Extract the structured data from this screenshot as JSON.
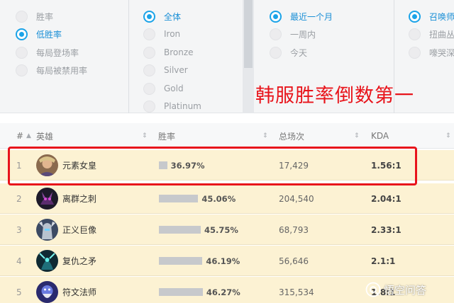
{
  "filters": {
    "stat_type": {
      "options": [
        {
          "label": "胜率",
          "selected": false
        },
        {
          "label": "低胜率",
          "selected": true
        },
        {
          "label": "每局登场率",
          "selected": false
        },
        {
          "label": "每局被禁用率",
          "selected": false
        }
      ]
    },
    "tier": {
      "options": [
        {
          "label": "全体",
          "selected": true
        },
        {
          "label": "Iron",
          "selected": false
        },
        {
          "label": "Bronze",
          "selected": false
        },
        {
          "label": "Silver",
          "selected": false
        },
        {
          "label": "Gold",
          "selected": false
        },
        {
          "label": "Platinum",
          "selected": false
        }
      ]
    },
    "period": {
      "options": [
        {
          "label": "最近一个月",
          "selected": true
        },
        {
          "label": "一周内",
          "selected": false
        },
        {
          "label": "今天",
          "selected": false
        }
      ]
    },
    "mode": {
      "options": [
        {
          "label": "召唤师",
          "selected": true
        },
        {
          "label": "扭曲丛",
          "selected": false
        },
        {
          "label": "嚎哭深",
          "selected": false
        }
      ]
    }
  },
  "annotation": "韩服胜率倒数第一",
  "table": {
    "headers": {
      "rank": "#",
      "champion": "英雄",
      "winrate": "胜率",
      "games": "总场次",
      "kda": "KDA"
    },
    "rows": [
      {
        "rank": "1",
        "champion": "元素女皇",
        "winrate": "36.97%",
        "winrate_value": 36.97,
        "games": "17,429",
        "kda": "1.56:1",
        "avatar_icon": "champion-qiyana-portrait"
      },
      {
        "rank": "2",
        "champion": "离群之刺",
        "winrate": "45.06%",
        "winrate_value": 45.06,
        "games": "204,540",
        "kda": "2.04:1",
        "avatar_icon": "champion-khazix-portrait"
      },
      {
        "rank": "3",
        "champion": "正义巨像",
        "winrate": "45.75%",
        "winrate_value": 45.75,
        "games": "68,793",
        "kda": "2.33:1",
        "avatar_icon": "champion-galio-portrait"
      },
      {
        "rank": "4",
        "champion": "复仇之矛",
        "winrate": "46.19%",
        "winrate_value": 46.19,
        "games": "56,646",
        "kda": "2.1:1",
        "avatar_icon": "champion-kalista-portrait"
      },
      {
        "rank": "5",
        "champion": "符文法师",
        "winrate": "46.27%",
        "winrate_value": 46.27,
        "games": "315,534",
        "kda": "1.8:1",
        "avatar_icon": "champion-ryze-portrait"
      }
    ]
  },
  "watermark": "悟空问答",
  "colors": {
    "accent": "#1aa3e8",
    "annotation": "#e8141b",
    "row_bg": "#fcf2d3",
    "bar": "#c7c9cc"
  }
}
